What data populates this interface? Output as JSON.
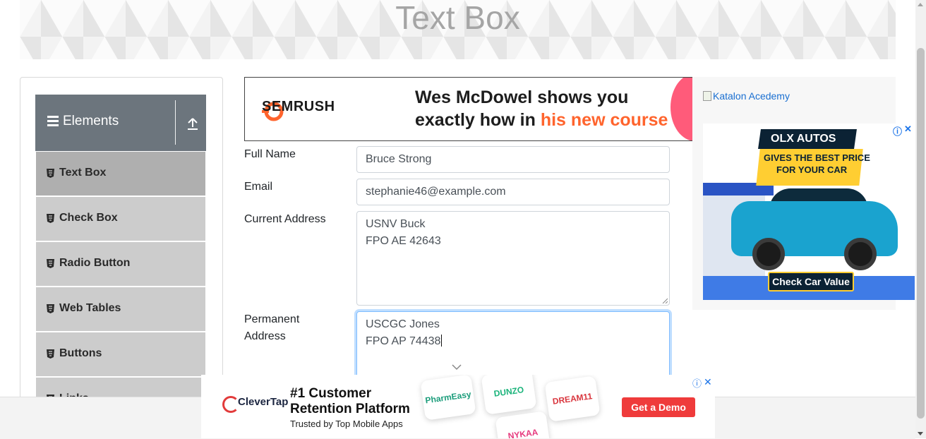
{
  "page": {
    "title": "Text Box"
  },
  "sidebar": {
    "group_label": "Elements",
    "items": [
      {
        "label": "Text Box",
        "active": true
      },
      {
        "label": "Check Box",
        "active": false
      },
      {
        "label": "Radio Button",
        "active": false
      },
      {
        "label": "Web Tables",
        "active": false
      },
      {
        "label": "Buttons",
        "active": false
      },
      {
        "label": "Links",
        "active": false
      }
    ]
  },
  "top_ad": {
    "brand": "SEMRUSH",
    "line1": "Wes McDowel shows you",
    "line2_prefix": "exactly how in ",
    "line2_highlight": "his new course",
    "highlight_color": "#ff642d"
  },
  "form": {
    "full_name": {
      "label": "Full Name",
      "value": "Bruce Strong"
    },
    "email": {
      "label": "Email",
      "value": "stephanie46@example.com"
    },
    "current_address": {
      "label": "Current Address",
      "line1": "USNV Buck",
      "line2": "FPO AE 42643"
    },
    "permanent_address": {
      "label_line1": "Permanent",
      "label_line2": "Address",
      "line1": "USCGC Jones",
      "line2": "FPO AP 74438"
    }
  },
  "right_ad": {
    "alt_text": "Katalon Acedemy",
    "brand": "OLX AUTOS",
    "tagline1": "GIVES THE BEST PRICE",
    "tagline2": "FOR YOUR CAR",
    "cta": "Check Car Value"
  },
  "bottom_ad": {
    "brand": "CleverTap",
    "headline1": "#1 Customer",
    "headline2": "Retention Platform",
    "subline": "Trusted by Top Mobile Apps",
    "tiles": [
      "PharmEasy",
      "DUNZO",
      "DREAM11",
      "NYKAA"
    ],
    "cta": "Get a Demo"
  },
  "colors": {
    "sidebar_header": "#6c757d",
    "menu_item": "#cccccc",
    "menu_item_active": "#afafaf",
    "focus_border": "#80bdff",
    "cta_red": "#ef3b3b"
  }
}
